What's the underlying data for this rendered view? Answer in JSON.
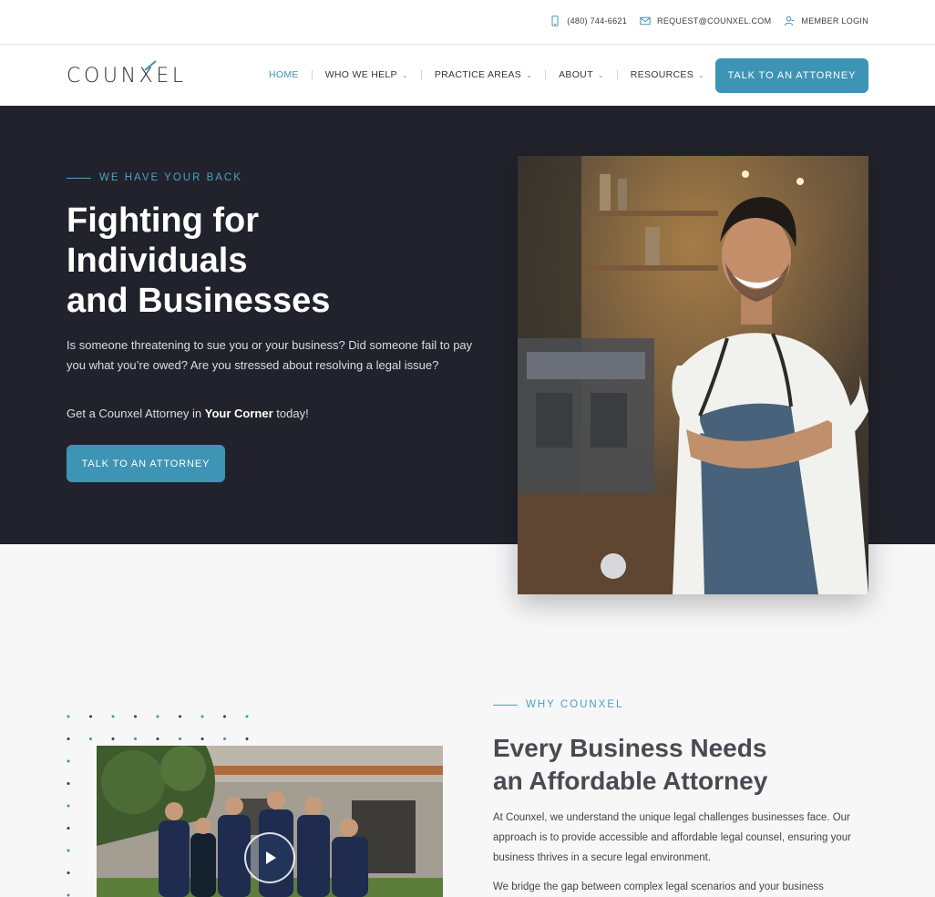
{
  "utility": {
    "phone": "(480) 744-6621",
    "email": "REQUEST@COUNXEL.COM",
    "login": "MEMBER LOGIN"
  },
  "brand": {
    "name_part1": "COUN",
    "name_x": "X",
    "name_part2": "EL",
    "accent": "#3e94b4",
    "dark": "#22222c"
  },
  "nav": {
    "items": [
      {
        "label": "HOME",
        "active": true
      },
      {
        "label": "WHO WE HELP"
      },
      {
        "label": "PRACTICE AREAS"
      },
      {
        "label": "ABOUT"
      },
      {
        "label": "RESOURCES"
      }
    ],
    "cta": "TALK TO AN ATTORNEY"
  },
  "hero": {
    "eyebrow": "WE HAVE YOUR BACK",
    "title_line1": "Fighting for",
    "title_line2": "Individuals",
    "title_line3": "and Businesses",
    "paragraph": "Is someone threatening to sue you or your business? Did someone fail to pay you what you’re owed? Are you stressed about resolving a legal issue?",
    "cta_line_pre": "Get a Counxel Attorney in ",
    "cta_line_bold": "Your Corner",
    "cta_line_post": " today!",
    "button": "TALK TO AN ATTORNEY"
  },
  "why": {
    "eyebrow": "WHY COUNXEL",
    "title_line1": "Every Business Needs",
    "title_line2": "an Affordable Attorney",
    "paragraph1": "At Counxel, we understand the unique legal challenges businesses face. Our approach is to provide accessible and affordable legal counsel, ensuring your business thrives in a secure legal environment.",
    "paragraph2": "We bridge the gap between complex legal scenarios and your business"
  },
  "icons": {
    "phone": "phone-icon",
    "email": "mail-icon",
    "login": "user-icon",
    "play": "play-icon"
  }
}
